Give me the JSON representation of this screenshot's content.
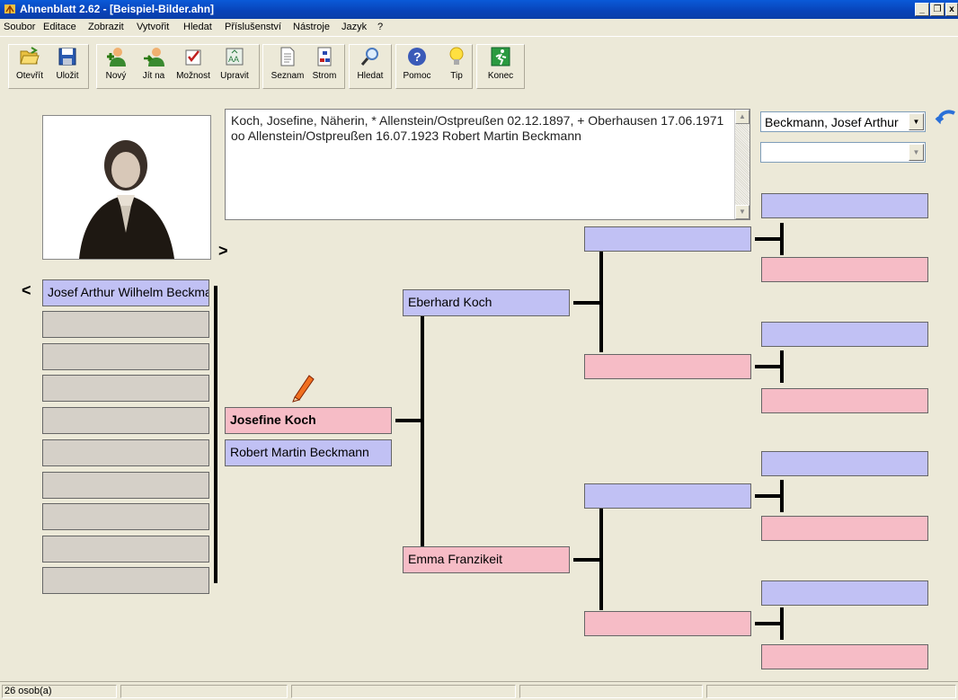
{
  "window": {
    "title": "Ahnenblatt 2.62 - [Beispiel-Bilder.ahn]"
  },
  "menu": [
    "Soubor",
    "Editace",
    "Zobrazit",
    "Vytvořit",
    "Hledat",
    "Příslušenství",
    "Nástroje",
    "Jazyk",
    "?"
  ],
  "toolbar": {
    "open": "Otevřít",
    "save": "Uložit",
    "new": "Nový",
    "goto": "Jít na",
    "options": "Možnost",
    "edit": "Upravit",
    "list": "Seznam",
    "tree": "Strom",
    "search": "Hledat",
    "help": "Pomoc",
    "tip": "Tip",
    "exit": "Konec"
  },
  "info": {
    "line1": "Koch, Josefine, Näherin, * Allenstein/Ostpreußen 02.12.1897, + Oberhausen 17.06.1971",
    "line2": "oo Allenstein/Ostpreußen 16.07.1923 Robert Martin Beckmann"
  },
  "combos": {
    "person_select": "Beckmann, Josef Arthur",
    "second_select": ""
  },
  "nav": {
    "next": ">",
    "prev": "<"
  },
  "children": [
    "Josef Arthur Wilhelm Beckmann",
    "",
    "",
    "",
    "",
    "",
    "",
    "",
    "",
    ""
  ],
  "proband": {
    "name": "Josefine Koch",
    "spouse": "Robert Martin Beckmann"
  },
  "parents": {
    "father": "Eberhard Koch",
    "mother": "Emma Franzikeit"
  },
  "grandparents": [
    "",
    "",
    "",
    ""
  ],
  "great_grandparents": [
    "",
    "",
    "",
    "",
    "",
    "",
    "",
    ""
  ],
  "status": {
    "count": "26 osob(a)"
  }
}
